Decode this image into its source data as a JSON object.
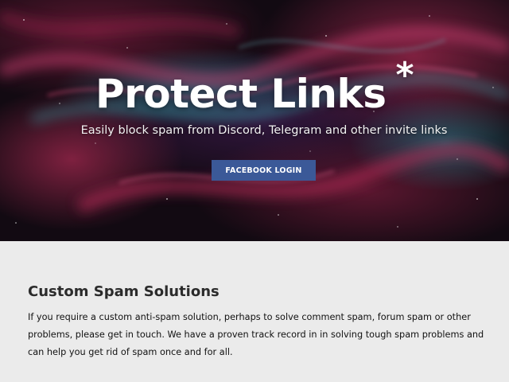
{
  "hero": {
    "title": "Protect Links",
    "asterisk": "*",
    "subtitle": "Easily block spam from Discord, Telegram and other invite links",
    "login_button": "FACEBOOK LOGIN"
  },
  "section": {
    "heading": "Custom Spam Solutions",
    "body_before_link": "If you require a custom anti-spam solution, perhaps to solve comment spam, forum spam or other problems, please ",
    "link_text": "get in touch",
    "body_after_link": ". We have a proven track record in in solving tough spam problems and can help you get rid of spam once and for all."
  },
  "colors": {
    "facebook_blue": "#3b5998",
    "content_background": "#ebebeb",
    "hero_text": "#ffffff"
  }
}
